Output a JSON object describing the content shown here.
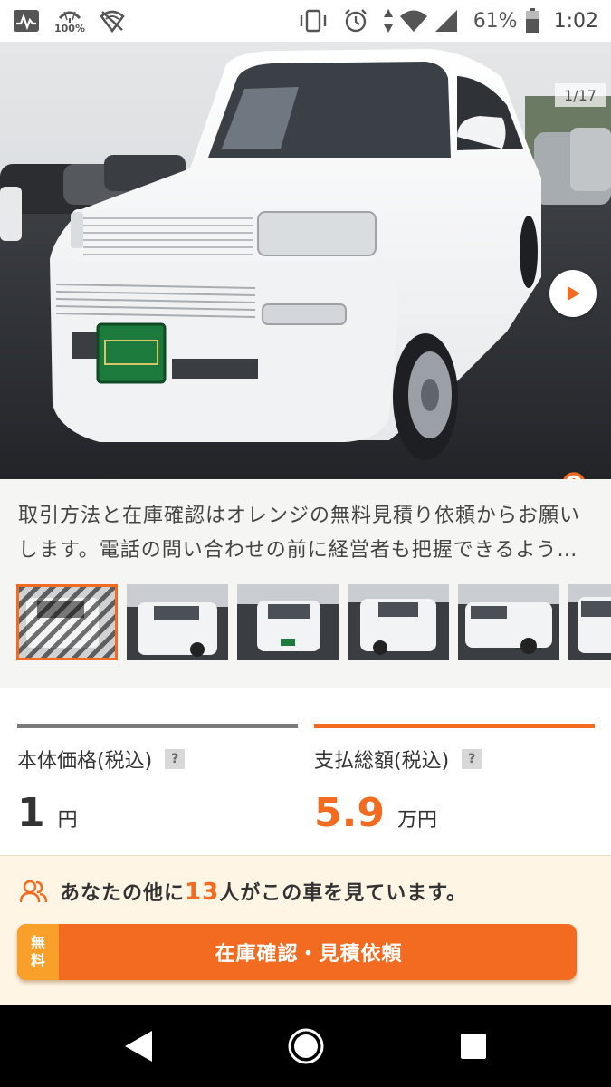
{
  "status_bar": {
    "battery_saver_label": "100%",
    "battery_percent": "61%",
    "time": "1:02"
  },
  "gallery": {
    "counter": "1/17",
    "thumbnail_count": 6,
    "active_thumbnail": 1
  },
  "description": {
    "text": "取引方法と在庫確認はオレンジの無料見積り依頼からお願いします。電話の問い合わせの前に経営者も把握できるよう無料…"
  },
  "prices": {
    "body": {
      "label": "本体価格(税込)",
      "help": "?",
      "value": "1",
      "unit": "円",
      "color": "#333333",
      "bar_color": "#7a7a7a"
    },
    "total": {
      "label": "支払総額(税込)",
      "help": "?",
      "value": "5.9",
      "unit": "万円",
      "color": "#f26b21",
      "bar_color": "#f26b21"
    }
  },
  "viewers": {
    "prefix": "あなたの他に",
    "count": "13",
    "suffix": "人がこの車を見ています。"
  },
  "cta": {
    "free_line1": "無",
    "free_line2": "料",
    "label": "在庫確認・見積依頼"
  },
  "colors": {
    "accent": "#f26b21",
    "accent_light": "#f9a02a",
    "cta_background": "#fff5e4"
  },
  "icons": {
    "status": [
      "activity-icon",
      "battery-saver-icon",
      "vpn-shield-icon",
      "vibrate-icon",
      "alarm-icon",
      "data-arrows-icon",
      "wifi-icon",
      "signal-icon",
      "battery-icon"
    ],
    "nav": [
      "back-icon",
      "home-icon",
      "recents-icon"
    ]
  }
}
